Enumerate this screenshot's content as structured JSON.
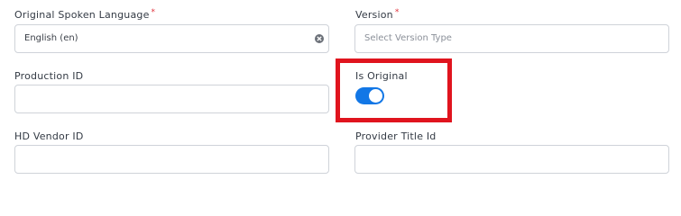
{
  "fields": {
    "original_language": {
      "label": "Original Spoken Language",
      "required_mark": "*",
      "value": "English (en)"
    },
    "version": {
      "label": "Version",
      "required_mark": "*",
      "placeholder": "Select Version Type"
    },
    "production_id": {
      "label": "Production ID",
      "value": ""
    },
    "is_original": {
      "label": "Is Original",
      "checked": true
    },
    "hd_vendor_id": {
      "label": "HD Vendor ID",
      "value": ""
    },
    "provider_title_id": {
      "label": "Provider Title Id",
      "value": ""
    }
  },
  "colors": {
    "toggle_on": "#1277e6",
    "highlight": "#e0141e",
    "required": "#e0303a"
  },
  "icons": {
    "clear": "clear-icon"
  }
}
